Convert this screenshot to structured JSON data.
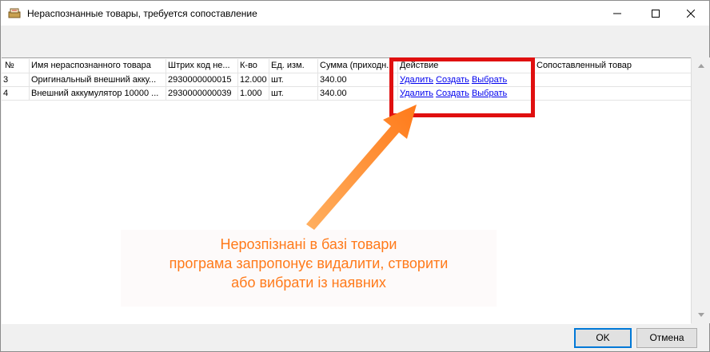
{
  "window": {
    "title": "Нераспознанные товары, требуется сопоставление",
    "minimize_glyph": "—",
    "maximize_glyph": "☐",
    "close_glyph": "✕"
  },
  "table": {
    "columns": [
      "№",
      "Имя нераспознанного товара",
      "Штрих код не...",
      "К-во",
      "Ед. изм.",
      "Сумма (приходн...",
      "Действие",
      "Сопоставленный товар"
    ],
    "rows": [
      {
        "num": "3",
        "name": "Оригинальный внешний акку...",
        "barcode": "2930000000015",
        "qty": "12.000",
        "unit": "шт.",
        "sum": "340.00",
        "matched": ""
      },
      {
        "num": "4",
        "name": "Внешний аккумулятор 10000 ...",
        "barcode": "2930000000039",
        "qty": "1.000",
        "unit": "шт.",
        "sum": "340.00",
        "matched": ""
      }
    ],
    "actions": {
      "delete": "Удалить",
      "create": "Создать",
      "select": "Выбрать"
    }
  },
  "annotation": {
    "lines": [
      "Нерозпізнані в базі товари",
      "програма запропонує видалити, створити",
      "або вибрати із наявних"
    ],
    "color": "#ff7a1a",
    "box_color": "#e01010"
  },
  "buttons": {
    "ok": "OK",
    "cancel": "Отмена"
  }
}
